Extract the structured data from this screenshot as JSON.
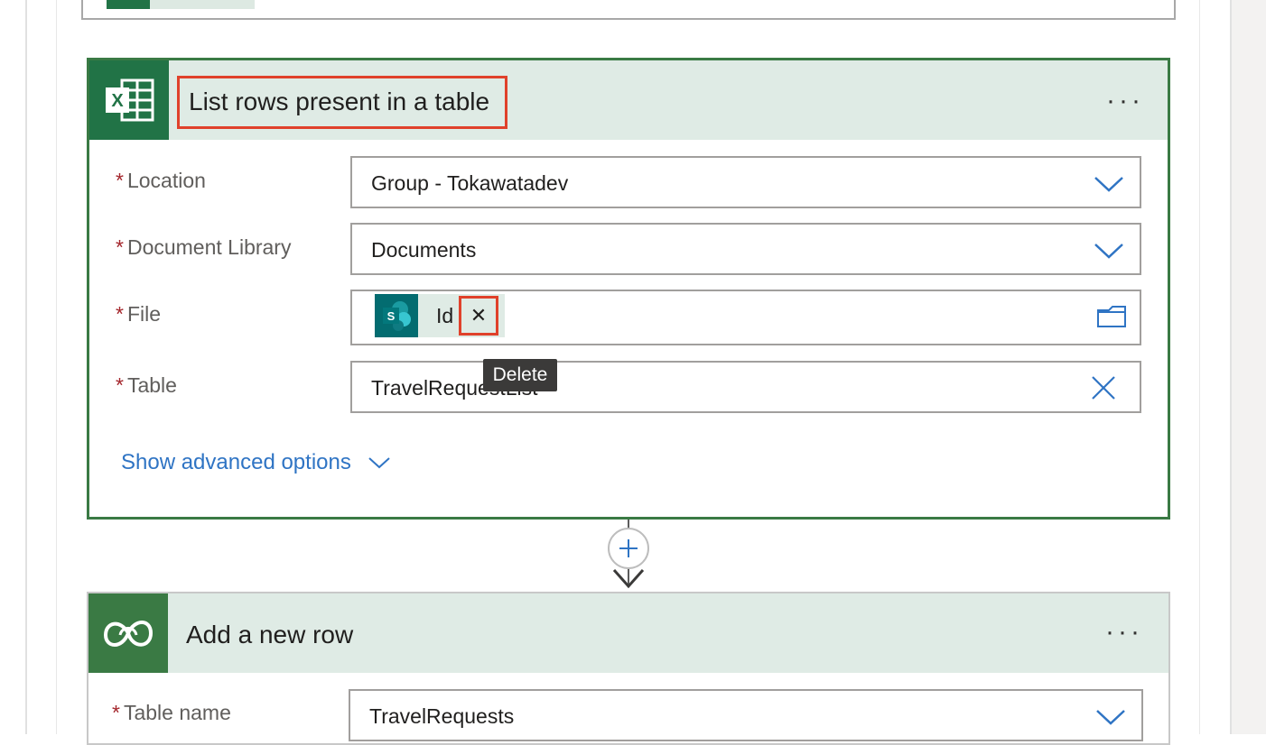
{
  "card1": {
    "title": "List rows present in a table",
    "more_label": "···",
    "fields": {
      "location": {
        "label": "Location",
        "value": "Group - Tokawatadev"
      },
      "doc_library": {
        "label": "Document Library",
        "value": "Documents"
      },
      "file": {
        "label": "File",
        "token_text": "Id",
        "remove_glyph": "✕"
      },
      "table": {
        "label": "Table",
        "value": "TravelRequestList"
      }
    },
    "required_marker": "*",
    "show_advanced": "Show advanced options"
  },
  "tooltip": {
    "text": "Delete"
  },
  "card2": {
    "title": "Add a new row",
    "more_label": "···",
    "fields": {
      "table_name": {
        "label": "Table name",
        "value": "TravelRequests"
      }
    }
  },
  "colors": {
    "excel_green": "#217346",
    "accent_blue": "#2f74c4",
    "highlight_red": "#e0412b",
    "header_bg": "#dfebe5"
  },
  "icons": [
    "excel-icon",
    "chevron-down-icon",
    "sharepoint-icon",
    "close-icon",
    "folder-icon",
    "plus-icon",
    "arrow-down-icon",
    "dataverse-icon",
    "more-icon"
  ]
}
